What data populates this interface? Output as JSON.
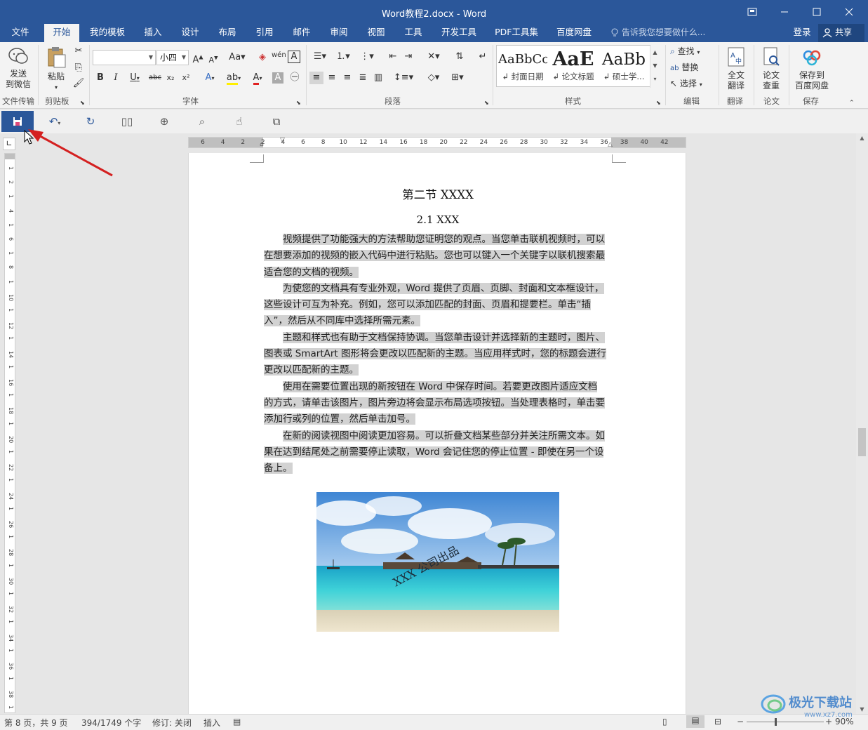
{
  "window": {
    "title": "Word教程2.docx - Word"
  },
  "tabs": [
    {
      "label": "文件"
    },
    {
      "label": "开始"
    },
    {
      "label": "我的模板"
    },
    {
      "label": "插入"
    },
    {
      "label": "设计"
    },
    {
      "label": "布局"
    },
    {
      "label": "引用"
    },
    {
      "label": "邮件"
    },
    {
      "label": "审阅"
    },
    {
      "label": "视图"
    },
    {
      "label": "工具"
    },
    {
      "label": "开发工具"
    },
    {
      "label": "PDF工具集"
    },
    {
      "label": "百度网盘"
    }
  ],
  "active_tab": "开始",
  "tell_me": "告诉我您想要做什么...",
  "account": {
    "login": "登录",
    "share": "共享"
  },
  "ribbon": {
    "send_wechat": "发送\n到微信",
    "paste": "粘贴",
    "font_name": "",
    "font_size": "小四",
    "style_samples": [
      {
        "sample": "AaBbCc",
        "name": "封面日期"
      },
      {
        "sample": "AaE",
        "name": "论文标题"
      },
      {
        "sample": "AaBb",
        "name": "硕士学..."
      }
    ],
    "find": "查找",
    "replace": "替换",
    "select": "选择",
    "full_translate": "全文\n翻译",
    "paper_check": "论文\n查重",
    "save_baidu": "保存到\n百度网盘",
    "groups": {
      "file_transfer": "文件传输",
      "clipboard": "剪贴板",
      "font": "字体",
      "paragraph": "段落",
      "styles": "样式",
      "editing": "编辑",
      "translate": "翻译",
      "paper": "论文",
      "save": "保存"
    }
  },
  "ruler": {
    "numbers": [
      "6",
      "4",
      "2",
      "2",
      "4",
      "6",
      "8",
      "10",
      "12",
      "14",
      "16",
      "18",
      "20",
      "22",
      "24",
      "26",
      "28",
      "30",
      "32",
      "34",
      "36",
      "38",
      "40",
      "42"
    ],
    "vertical_numbers": [
      "1",
      "2",
      "1",
      "4",
      "1",
      "6",
      "1",
      "8",
      "1",
      "10",
      "1",
      "12",
      "1",
      "14",
      "1",
      "16",
      "1",
      "18",
      "1",
      "20",
      "1",
      "22",
      "1",
      "24",
      "1",
      "26",
      "1",
      "28",
      "1",
      "30",
      "1",
      "32",
      "1",
      "34",
      "1",
      "36",
      "1",
      "38",
      "1",
      "40"
    ]
  },
  "document": {
    "section_title": "第二节  XXXX",
    "subsection_title": "2.1 XXX",
    "paragraphs": [
      "视频提供了功能强大的方法帮助您证明您的观点。当您单击联机视频时，可以在想要添加的视频的嵌入代码中进行粘贴。您也可以键入一个关键字以联机搜索最适合您的文档的视频。",
      "为使您的文档具有专业外观，Word 提供了页眉、页脚、封面和文本框设计，这些设计可互为补充。例如，您可以添加匹配的封面、页眉和提要栏。单击“插入”，然后从不同库中选择所需元素。",
      "主题和样式也有助于文档保持协调。当您单击设计并选择新的主题时，图片、图表或 SmartArt 图形将会更改以匹配新的主题。当应用样式时，您的标题会进行更改以匹配新的主题。",
      "使用在需要位置出现的新按钮在 Word 中保存时间。若要更改图片适应文档的方式，请单击该图片，图片旁边将会显示布局选项按钮。当处理表格时，单击要添加行或列的位置，然后单击加号。",
      "在新的阅读视图中阅读更加容易。可以折叠文档某些部分并关注所需文本。如果在达到结尾处之前需要停止读取，Word 会记住您的停止位置 - 即使在另一个设备上。"
    ],
    "image_watermark": "XXX 公司出品"
  },
  "status": {
    "page": "第 8 页，共 9 页",
    "words": "394/1749 个字",
    "revision": "修订: 关闭",
    "mode": "插入",
    "zoom": "90%"
  },
  "site_logo": {
    "text": "极光下载站",
    "url": "www.xz7.com"
  },
  "colors": {
    "accent": "#2b579a",
    "selection": "#d2d2d2",
    "arrow": "#d42020"
  }
}
